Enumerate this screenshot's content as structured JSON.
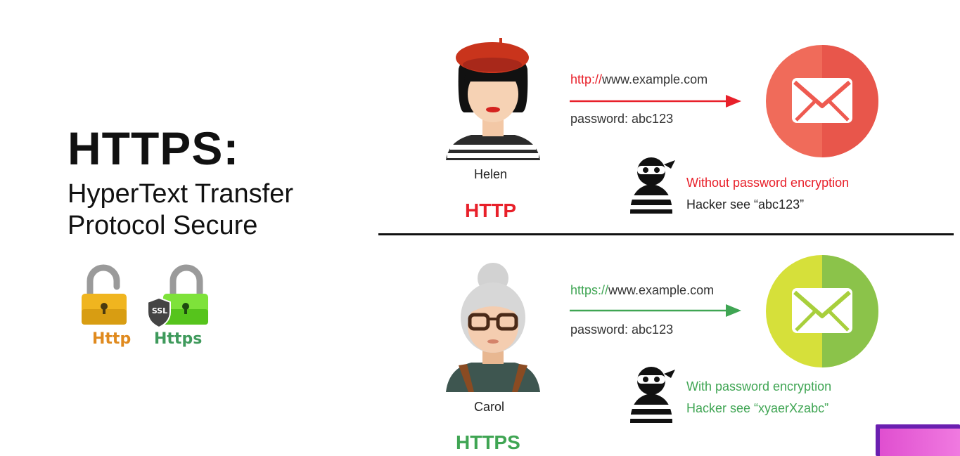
{
  "title": "HTTPS:",
  "subtitle_line1": "HyperText Transfer",
  "subtitle_line2": "Protocol Secure",
  "locks": {
    "http_label": "Http",
    "https_label": "Https",
    "ssl_badge": "SSL"
  },
  "http_section": {
    "person_name": "Helen",
    "protocol": "HTTP",
    "url_scheme": "http://",
    "url_host": "www.example.com",
    "password": "password: abc123",
    "note_line1": "Without password encryption",
    "note_line2": "Hacker see “abc123”",
    "accent_color": "#e8202a",
    "mail_color": "#ee5a50"
  },
  "https_section": {
    "person_name": "Carol",
    "protocol": "HTTPS",
    "url_scheme": "https://",
    "url_host": "www.example.com",
    "password": "password: abc123",
    "note_line1": "With password encryption",
    "note_line2": "Hacker see “xyaerXzabc”",
    "accent_color": "#3fa553",
    "mail_color": "#9ccc3c"
  }
}
